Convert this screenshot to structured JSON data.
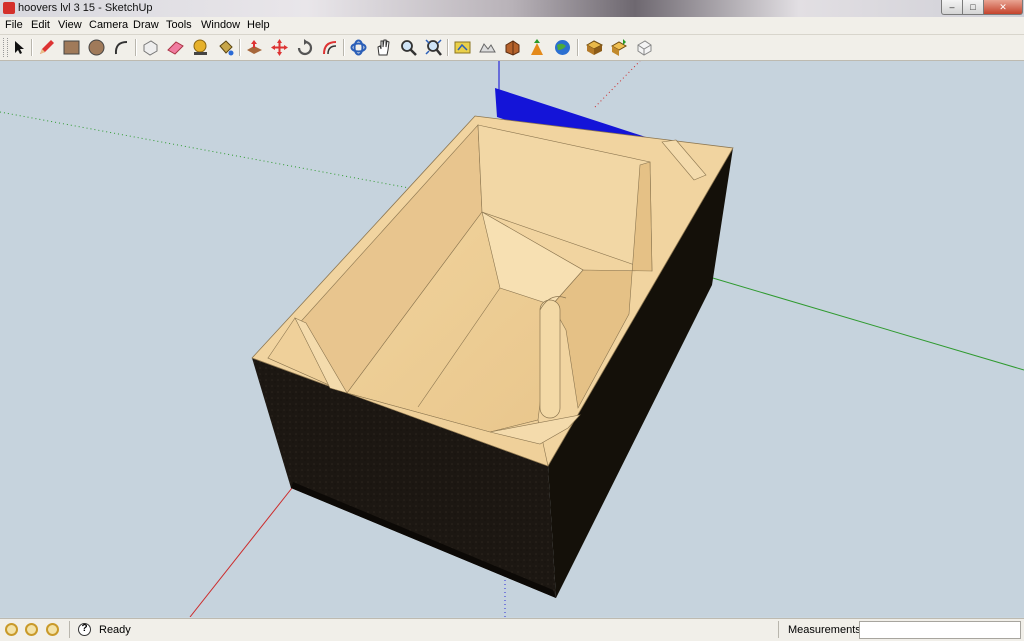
{
  "window": {
    "title": "hoovers lvl 3 15 - SketchUp"
  },
  "window_controls": {
    "minimize": "–",
    "maximize": "□",
    "close": "✕"
  },
  "menu": [
    "File",
    "Edit",
    "View",
    "Camera",
    "Draw",
    "Tools",
    "Window",
    "Help"
  ],
  "toolbar": {
    "tools": [
      {
        "name": "select-icon"
      },
      {
        "name": "pencil-icon"
      },
      {
        "name": "rectangle-icon"
      },
      {
        "name": "circle-icon"
      },
      {
        "name": "arc-icon"
      },
      {
        "name": "make-component-icon"
      },
      {
        "name": "eraser-icon"
      },
      {
        "name": "tape-measure-icon"
      },
      {
        "name": "paint-bucket-icon"
      },
      {
        "name": "push-pull-icon"
      },
      {
        "name": "move-icon"
      },
      {
        "name": "rotate-icon"
      },
      {
        "name": "offset-icon"
      },
      {
        "name": "orbit-icon"
      },
      {
        "name": "pan-icon"
      },
      {
        "name": "zoom-icon"
      },
      {
        "name": "zoom-extents-icon"
      },
      {
        "name": "add-location-icon"
      },
      {
        "name": "toggle-terrain-icon"
      },
      {
        "name": "get-models-icon"
      },
      {
        "name": "share-model-icon"
      },
      {
        "name": "google-earth-icon"
      },
      {
        "name": "components-icon"
      },
      {
        "name": "share-component-icon"
      },
      {
        "name": "extension-icon"
      }
    ]
  },
  "status": {
    "text": "Ready",
    "measurements_label": "Measurements",
    "measurements_value": ""
  },
  "colors": {
    "sky": "#c6d3dd",
    "wood": "#f1d4a0",
    "wood_dark": "#d9b27a",
    "carpet": "#1c1712",
    "blue_panel": "#1414d8",
    "axis_red": "#cc2b2b",
    "axis_green": "#2f9a2f",
    "axis_blue": "#2a2ad8"
  }
}
